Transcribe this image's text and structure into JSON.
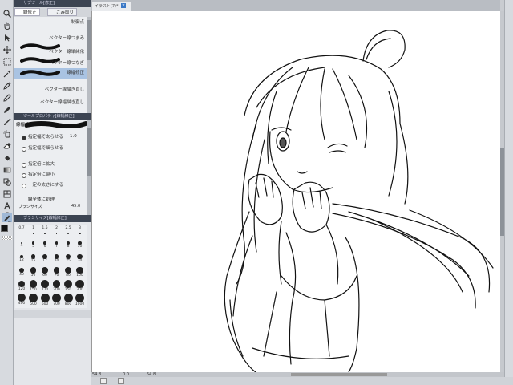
{
  "sub_tool_panel": {
    "title": "サブツール[修正]",
    "tabs": [
      "線修正",
      "ごみ取り"
    ],
    "items": [
      {
        "label": "制御点",
        "preview": "none"
      },
      {
        "label": "ベクター線つまみ",
        "preview": "none"
      },
      {
        "label": "ベクター線単純化",
        "preview": "stroke"
      },
      {
        "label": "ベクター線つなぎ",
        "preview": "stroke"
      },
      {
        "label": "線幅修正",
        "preview": "stroke",
        "selected": true
      },
      {
        "label": "ベクター線描き直し",
        "preview": "none"
      },
      {
        "label": "ベクター線幅描き直し",
        "preview": "none"
      }
    ]
  },
  "tool_property": {
    "title": "ツールプロパティ[線幅修正]",
    "tool_name": "線幅修正",
    "options": [
      {
        "label": "指定幅で太らせる",
        "on": true
      },
      {
        "label": "指定幅で細らせる",
        "on": false
      },
      {
        "label": "指定倍に拡大",
        "on": false
      },
      {
        "label": "指定倍に縮小",
        "on": false
      },
      {
        "label": "一定の太さにする",
        "on": false
      }
    ],
    "value": "1.0",
    "apply_all": "線全体に処理",
    "brush_size_label": "ブラシサイズ",
    "brush_size_value": "45.0"
  },
  "brush_size_panel": {
    "title": "ブラシサイズ[線幅修正]",
    "sizes": [
      "0.7",
      "1",
      "1.5",
      "2",
      "2.5",
      "3",
      "4",
      "5",
      "6",
      "7",
      "8",
      "10",
      "12",
      "15",
      "17",
      "20",
      "25",
      "30",
      "40",
      "50",
      "60",
      "70",
      "80",
      "100",
      "120",
      "150",
      "170",
      "200",
      "250",
      "300",
      "400",
      "500",
      "600",
      "700",
      "800",
      "1000"
    ]
  },
  "canvas": {
    "tab_title": "イラスト(7)*",
    "zoom_text": "54.8",
    "angle_text": "0.0",
    "rotation_text": "54.8"
  },
  "colors": {
    "main": "#111111",
    "sub": "#ffffff",
    "transparent": "checker"
  }
}
